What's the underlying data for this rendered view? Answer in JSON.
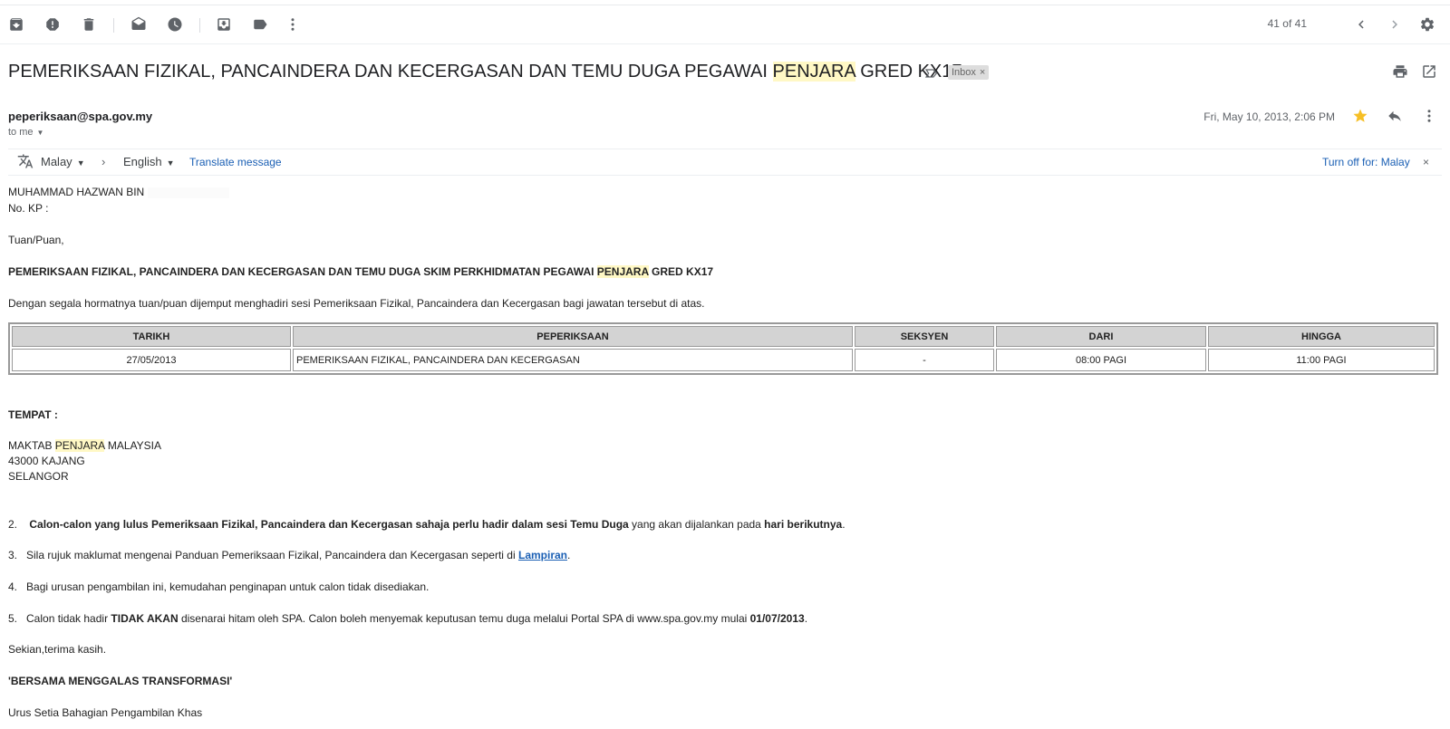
{
  "toolbar": {
    "icons": [
      "archive-icon",
      "report-spam-icon",
      "delete-icon",
      "mark-unread-icon",
      "snooze-icon",
      "move-to-icon",
      "label-icon",
      "more-icon"
    ],
    "pager": "41 of 41"
  },
  "email": {
    "subject_pre": "PEMERIKSAAN FIZIKAL, PANCAINDERA DAN KECERGASAN DAN TEMU DUGA PEGAWAI ",
    "subject_hl": "PENJARA",
    "subject_post": " GRED KX17",
    "label": "Inbox",
    "label_close": "×",
    "sender": "peperiksaan@spa.gov.my",
    "to": "to me",
    "date": "Fri, May 10, 2013, 2:06 PM"
  },
  "translate": {
    "from": "Malay",
    "arrow": "›",
    "to": "English",
    "action": "Translate message",
    "turn_off": "Turn off for: Malay",
    "close": "×"
  },
  "body": {
    "name": "MUHAMMAD HAZWAN BIN",
    "kp": "No. KP :",
    "greeting": "Tuan/Puan,",
    "heading_pre": "PEMERIKSAAN FIZIKAL, PANCAINDERA DAN KECERGASAN DAN TEMU DUGA SKIM PERKHIDMATAN PEGAWAI ",
    "heading_hl": "PENJARA",
    "heading_post": " GRED KX17",
    "intro": "Dengan segala hormatnya tuan/puan dijemput menghadiri sesi Pemeriksaan Fizikal, Pancaindera dan Kecergasan bagi jawatan tersebut di atas.",
    "table": {
      "headers": [
        "TARIKH",
        "PEPERIKSAAN",
        "SEKSYEN",
        "DARI",
        "HINGGA"
      ],
      "row": [
        "27/05/2013",
        "PEMERIKSAAN FIZIKAL, PANCAINDERA DAN KECERGASAN",
        "-",
        "08:00 PAGI",
        "11:00 PAGI"
      ]
    },
    "tempat_label": "TEMPAT :",
    "addr1_pre": "MAKTAB ",
    "addr1_hl": "PENJARA",
    "addr1_post": " MALAYSIA",
    "addr2": "43000 KAJANG",
    "addr3": "SELANGOR",
    "p2_num": "2.",
    "p2_bold": "Calon-calon yang lulus Pemeriksaan Fizikal, Pancaindera dan Kecergasan sahaja perlu hadir dalam sesi Temu Duga",
    "p2_mid": " yang akan dijalankan pada ",
    "p2_bold2": "hari berikutnya",
    "p2_end": ".",
    "p3_text": "3.   Sila rujuk maklumat mengenai Panduan Pemeriksaan Fizikal, Pancaindera dan Kecergasan seperti di ",
    "p3_link": "Lampiran",
    "p3_end": ".",
    "p4": "4.   Bagi urusan pengambilan ini, kemudahan penginapan untuk calon tidak disediakan.",
    "p5_pre": "5.   Calon tidak hadir ",
    "p5_bold": "TIDAK AKAN",
    "p5_mid": " disenarai hitam oleh SPA. Calon boleh menyemak keputusan temu duga melalui Portal SPA di www.spa.gov.my mulai ",
    "p5_bold2": "01/07/2013",
    "p5_end": ".",
    "closing": "Sekian,terima kasih.",
    "motto": "'BERSAMA MENGGALAS TRANSFORMASI'",
    "signoff": "Urus Setia Bahagian Pengambilan Khas"
  },
  "colors": {
    "highlight": "#fff8c5",
    "star": "#f6bf26",
    "link": "#1a5fb4"
  }
}
